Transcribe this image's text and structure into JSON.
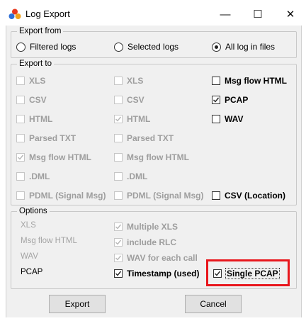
{
  "window": {
    "title": "Log Export",
    "minimize_glyph": "—",
    "maximize_glyph": "☐",
    "close_glyph": "✕",
    "icon": "app-icon"
  },
  "export_from": {
    "label": "Export from",
    "options": [
      {
        "label": "Filtered logs",
        "selected": false
      },
      {
        "label": "Selected logs",
        "selected": false
      },
      {
        "label": "All log in files",
        "selected": true
      }
    ]
  },
  "export_to": {
    "label": "Export to",
    "col1": [
      {
        "label": "XLS",
        "checked": false,
        "enabled": false
      },
      {
        "label": "CSV",
        "checked": false,
        "enabled": false
      },
      {
        "label": "HTML",
        "checked": false,
        "enabled": false
      },
      {
        "label": "Parsed TXT",
        "checked": false,
        "enabled": false
      },
      {
        "label": "Msg flow HTML",
        "checked": true,
        "enabled": false
      },
      {
        "label": ".DML",
        "checked": false,
        "enabled": false
      },
      {
        "label": "PDML (Signal Msg)",
        "checked": false,
        "enabled": false
      }
    ],
    "col2": [
      {
        "label": "XLS",
        "checked": false,
        "enabled": false
      },
      {
        "label": "CSV",
        "checked": false,
        "enabled": false
      },
      {
        "label": "HTML",
        "checked": true,
        "enabled": false
      },
      {
        "label": "Parsed TXT",
        "checked": false,
        "enabled": false
      },
      {
        "label": "Msg flow HTML",
        "checked": false,
        "enabled": false
      },
      {
        "label": ".DML",
        "checked": false,
        "enabled": false
      },
      {
        "label": "PDML (Signal Msg)",
        "checked": false,
        "enabled": false
      }
    ],
    "col3": [
      {
        "label": "Msg flow HTML",
        "checked": false,
        "enabled": true
      },
      {
        "label": "PCAP",
        "checked": true,
        "enabled": true
      },
      {
        "label": "WAV",
        "checked": false,
        "enabled": true
      },
      {
        "label": "CSV (Location)",
        "checked": false,
        "enabled": true
      }
    ]
  },
  "options": {
    "label": "Options",
    "rows": [
      {
        "name": "XLS",
        "enabled": false,
        "checkbox": {
          "label": "Multiple XLS",
          "checked": true,
          "enabled": false
        }
      },
      {
        "name": "Msg flow HTML",
        "enabled": false,
        "checkbox": {
          "label": "include RLC",
          "checked": true,
          "enabled": false
        }
      },
      {
        "name": "WAV",
        "enabled": false,
        "checkbox": {
          "label": "WAV for each call",
          "checked": true,
          "enabled": false
        }
      },
      {
        "name": "PCAP",
        "enabled": true,
        "checkbox": {
          "label": "Timestamp (used)",
          "checked": true,
          "enabled": true
        }
      }
    ],
    "single_pcap": {
      "label": "Single PCAP",
      "checked": true,
      "enabled": true,
      "highlight_color": "#e8161c"
    }
  },
  "buttons": {
    "export": "Export",
    "cancel": "Cancel"
  }
}
